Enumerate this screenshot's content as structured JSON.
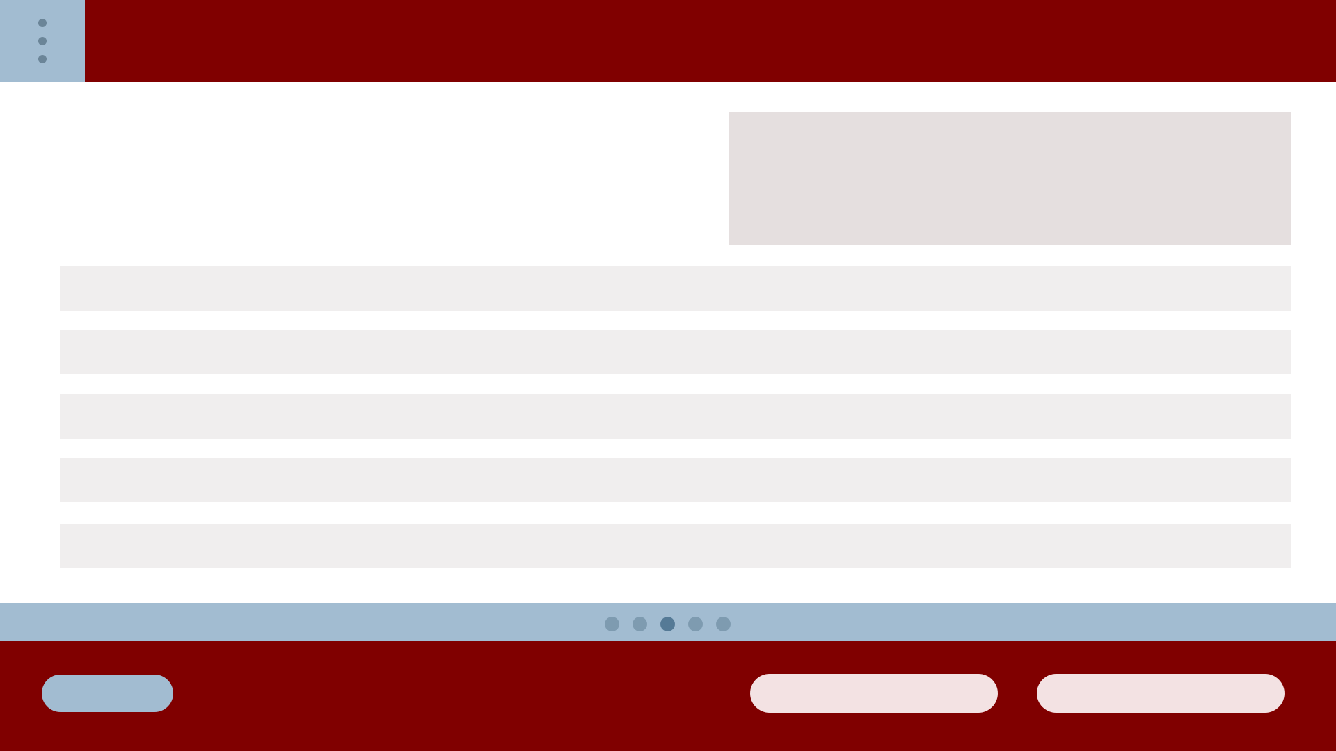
{
  "colors": {
    "brand": "#800000",
    "accent": "#a2bcd1",
    "placeholder_block": "#e5dfdf",
    "row_background": "#f0eeee",
    "pill_light": "#f3e2e3",
    "pager_dot": "#7e9bb0",
    "pager_dot_active": "#557a96"
  },
  "header": {
    "menu_icon": "kebab-menu-icon"
  },
  "main": {
    "rows": [
      "",
      "",
      "",
      "",
      ""
    ]
  },
  "pagination": {
    "total_pages": 5,
    "current_page": 3
  },
  "footer": {
    "left_button_label": "",
    "right_button_1_label": "",
    "right_button_2_label": ""
  }
}
